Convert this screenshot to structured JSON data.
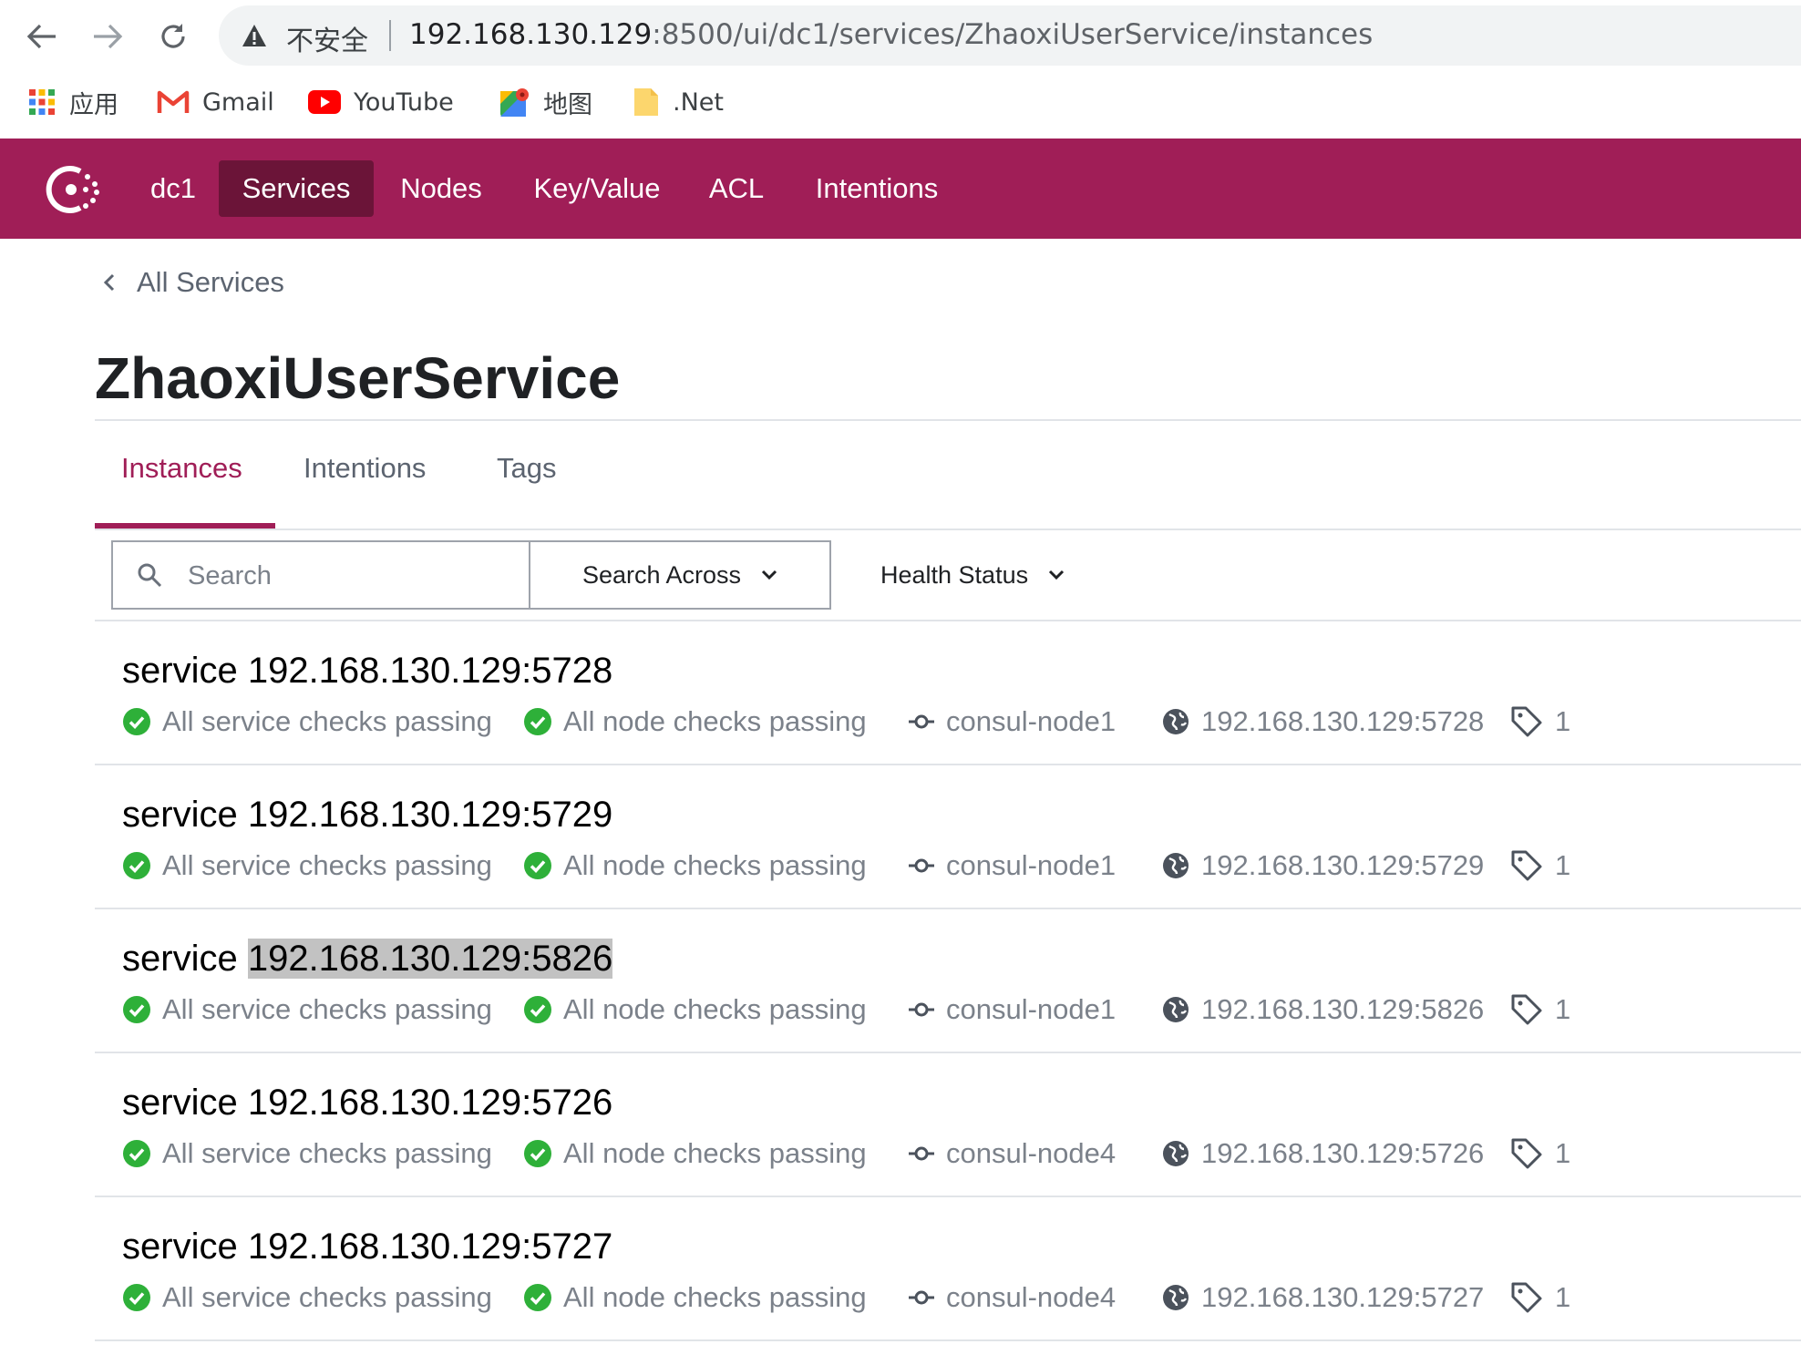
{
  "browser": {
    "security_label": "不安全",
    "url_host": "192.168.130.129",
    "url_path": ":8500/ui/dc1/services/ZhaoxiUserService/instances",
    "bookmarks": [
      {
        "label": "应用",
        "icon": "apps-grid-icon"
      },
      {
        "label": "Gmail",
        "icon": "gmail-icon"
      },
      {
        "label": "YouTube",
        "icon": "youtube-icon"
      },
      {
        "label": "地图",
        "icon": "maps-icon"
      },
      {
        "label": ".Net",
        "icon": "folder-icon"
      }
    ]
  },
  "topbar": {
    "brand_color": "#a01e57",
    "datacenter": "dc1",
    "nav": [
      "Services",
      "Nodes",
      "Key/Value",
      "ACL",
      "Intentions"
    ],
    "active_nav": "Services"
  },
  "page": {
    "back_label": "All Services",
    "title": "ZhaoxiUserService",
    "tabs": [
      "Instances",
      "Intentions",
      "Tags"
    ],
    "active_tab": "Instances"
  },
  "filters": {
    "search_placeholder": "Search",
    "search_across_label": "Search Across",
    "health_status_label": "Health Status"
  },
  "instances": [
    {
      "prefix": "service",
      "address": "192.168.130.129:5728",
      "service_checks": "All service checks passing",
      "node_checks": "All node checks passing",
      "node": "consul-node1",
      "endpoint": "192.168.130.129:5728",
      "tags": "1"
    },
    {
      "prefix": "service",
      "address": "192.168.130.129:5729",
      "service_checks": "All service checks passing",
      "node_checks": "All node checks passing",
      "node": "consul-node1",
      "endpoint": "192.168.130.129:5729",
      "tags": "1"
    },
    {
      "prefix": "service",
      "address": "192.168.130.129:5826",
      "service_checks": "All service checks passing",
      "node_checks": "All node checks passing",
      "node": "consul-node1",
      "endpoint": "192.168.130.129:5826",
      "tags": "1",
      "selected_text": true
    },
    {
      "prefix": "service",
      "address": "192.168.130.129:5726",
      "service_checks": "All service checks passing",
      "node_checks": "All node checks passing",
      "node": "consul-node4",
      "endpoint": "192.168.130.129:5726",
      "tags": "1"
    },
    {
      "prefix": "service",
      "address": "192.168.130.129:5727",
      "service_checks": "All service checks passing",
      "node_checks": "All node checks passing",
      "node": "consul-node4",
      "endpoint": "192.168.130.129:5727",
      "tags": "1"
    }
  ],
  "colors": {
    "passing": "#2eb039",
    "muted_text": "#7b818a",
    "active_tab": "#a01e57"
  }
}
